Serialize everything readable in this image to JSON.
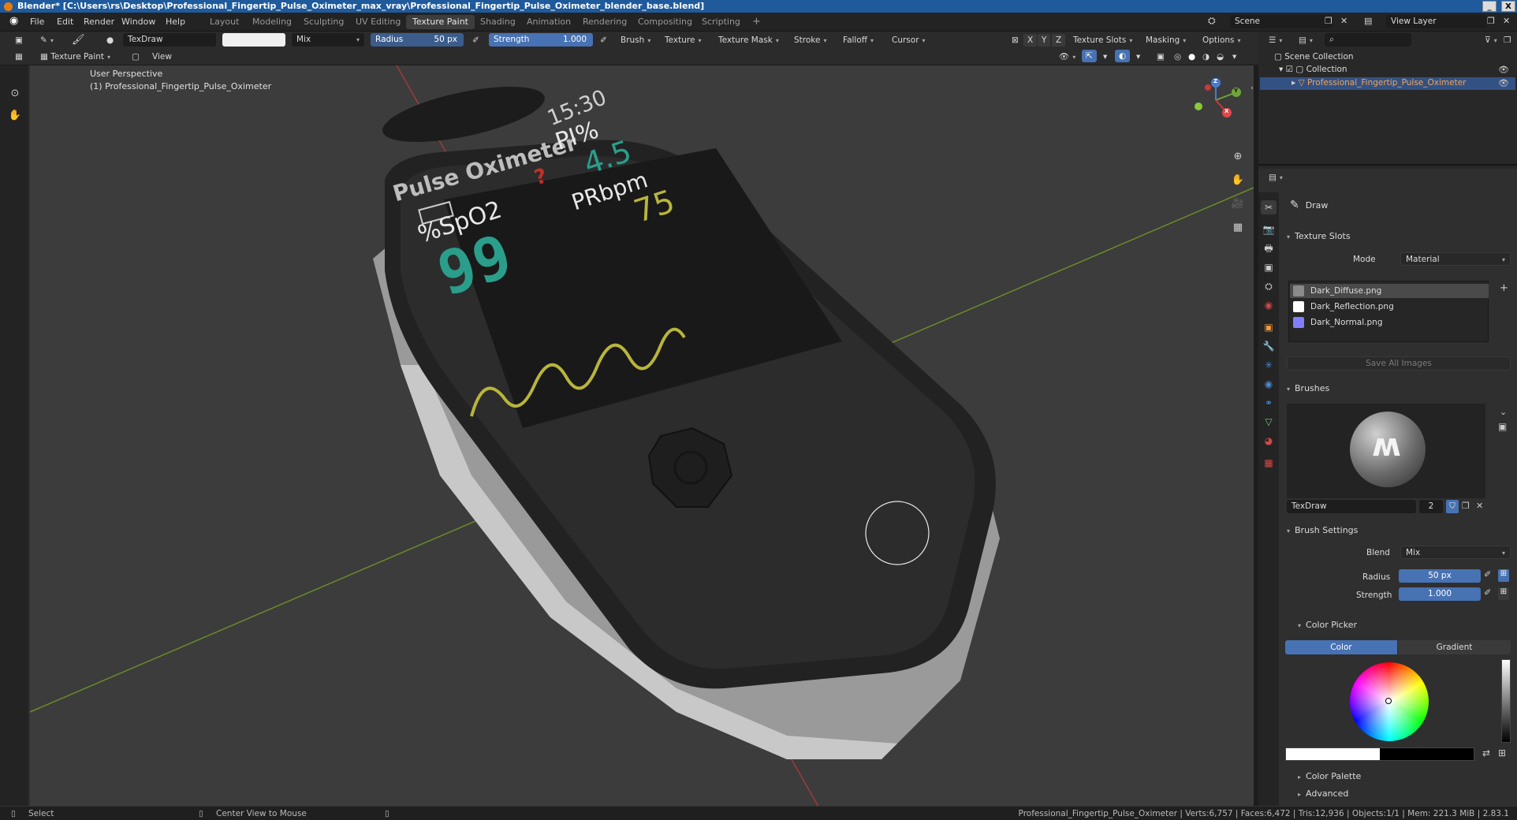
{
  "window": {
    "title": "Blender* [C:\\Users\\rs\\Desktop\\Professional_Fingertip_Pulse_Oximeter_max_vray\\Professional_Fingertip_Pulse_Oximeter_blender_base.blend]",
    "min": "_",
    "max": "▫",
    "close": "X"
  },
  "menu": [
    "File",
    "Edit",
    "Render",
    "Window",
    "Help"
  ],
  "workspaces": [
    "Layout",
    "Modeling",
    "Sculpting",
    "UV Editing",
    "Texture Paint",
    "Shading",
    "Animation",
    "Rendering",
    "Compositing",
    "Scripting",
    "+"
  ],
  "scene": {
    "name": "Scene",
    "view_layer": "View Layer"
  },
  "toolbar": {
    "brush_name": "TexDraw",
    "blend": "Mix",
    "radius_label": "Radius",
    "radius_value": "50 px",
    "strength_label": "Strength",
    "strength_value": "1.000",
    "dropdowns": [
      "Brush",
      "Texture",
      "Texture Mask",
      "Stroke",
      "Falloff",
      "Cursor"
    ],
    "axes": [
      "X",
      "Y",
      "Z"
    ],
    "right_dropdowns": [
      "Texture Slots",
      "Masking",
      "Options"
    ]
  },
  "mode_row": {
    "mode": "Texture Paint",
    "view": "View"
  },
  "viewport": {
    "perspective": "User Perspective",
    "object": "(1) Professional_Fingertip_Pulse_Oximeter",
    "gizmo": {
      "x": "X",
      "y": "Y",
      "z": "Z"
    }
  },
  "device_screen": {
    "brand": "Pulse Oximeter",
    "time": "15:30",
    "pi_label": "PI%",
    "pi_value": "4.5",
    "spo2_label": "%SpO2",
    "spo2_value": "99",
    "pr_label": "PRbpm",
    "pr_value": "75",
    "question": "?",
    "colors": {
      "teal": "#2a9e8a",
      "olive": "#b8b53c",
      "white": "#e8e8e8",
      "red": "#c0302a"
    }
  },
  "outliner": {
    "root": "Scene Collection",
    "collection": "Collection",
    "object": "Professional_Fingertip_Pulse_Oximeter"
  },
  "properties": {
    "tool_name": "Draw",
    "texture_slots_header": "Texture Slots",
    "mode_label": "Mode",
    "mode_value": "Material",
    "slots": [
      {
        "name": "Dark_Diffuse.png",
        "color": "#8a8a8a"
      },
      {
        "name": "Dark_Reflection.png",
        "color": "#ffffff"
      },
      {
        "name": "Dark_Normal.png",
        "color": "#8080ff"
      }
    ],
    "save_all": "Save All Images",
    "brushes_header": "Brushes",
    "brush_name": "TexDraw",
    "brush_users": "2",
    "brush_settings_header": "Brush Settings",
    "blend_label": "Blend",
    "blend_value": "Mix",
    "radius_label": "Radius",
    "radius_value": "50 px",
    "strength_label": "Strength",
    "strength_value": "1.000",
    "color_picker_header": "Color Picker",
    "color_tab": "Color",
    "gradient_tab": "Gradient",
    "color_palette": "Color Palette",
    "advanced": "Advanced"
  },
  "status": {
    "select": "Select",
    "center": "Center View to Mouse",
    "stats": "Professional_Fingertip_Pulse_Oximeter | Verts:6,757 | Faces:6,472 | Tris:12,936 | Objects:1/1 | Mem: 221.3 MiB | 2.83.1"
  },
  "accent": "#4772b3"
}
